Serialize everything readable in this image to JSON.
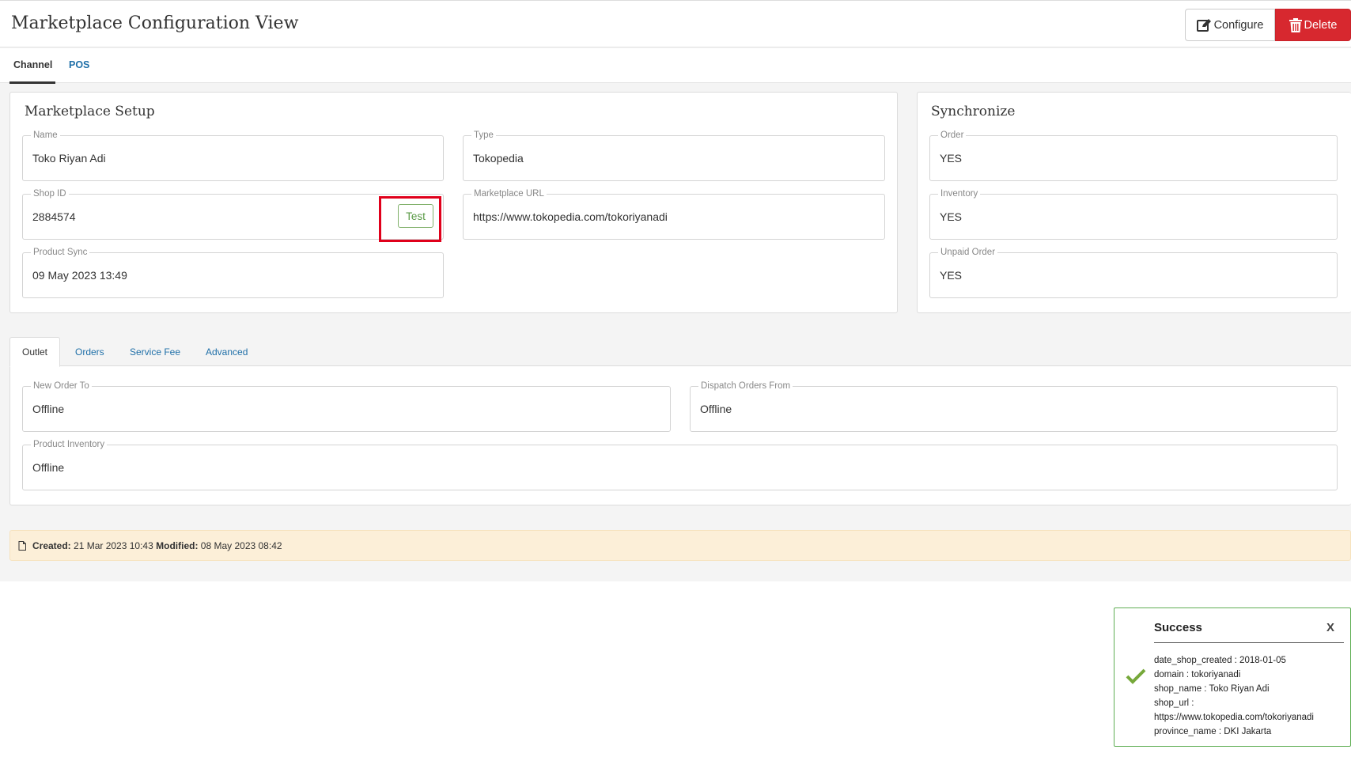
{
  "header": {
    "title": "Marketplace Configuration View",
    "configure_label": "Configure",
    "delete_label": "Delete"
  },
  "main_tabs": [
    {
      "label": "Channel",
      "active": true
    },
    {
      "label": "POS",
      "active": false
    }
  ],
  "setup": {
    "title": "Marketplace Setup",
    "name": {
      "label": "Name",
      "value": "Toko Riyan Adi"
    },
    "type": {
      "label": "Type",
      "value": "Tokopedia"
    },
    "shop_id": {
      "label": "Shop ID",
      "value": "2884574"
    },
    "test_label": "Test",
    "marketplace_url": {
      "label": "Marketplace URL",
      "value": "https://www.tokopedia.com/tokoriyanadi"
    },
    "product_sync": {
      "label": "Product Sync",
      "value": "09 May 2023 13:49"
    }
  },
  "synchronize": {
    "title": "Synchronize",
    "order": {
      "label": "Order",
      "value": "YES"
    },
    "inventory": {
      "label": "Inventory",
      "value": "YES"
    },
    "unpaid_order": {
      "label": "Unpaid Order",
      "value": "YES"
    }
  },
  "sub_tabs": [
    {
      "label": "Outlet",
      "active": true
    },
    {
      "label": "Orders",
      "active": false
    },
    {
      "label": "Service Fee",
      "active": false
    },
    {
      "label": "Advanced",
      "active": false
    }
  ],
  "outlet": {
    "new_order_to": {
      "label": "New Order To",
      "value": "Offline"
    },
    "dispatch_orders_from": {
      "label": "Dispatch Orders From",
      "value": "Offline"
    },
    "product_inventory": {
      "label": "Product Inventory",
      "value": "Offline"
    }
  },
  "info": {
    "created_label": "Created:",
    "created_value": "21 Mar 2023 10:43",
    "modified_label": "Modified:",
    "modified_value": "08 May 2023 08:42"
  },
  "toast": {
    "title": "Success",
    "close": "X",
    "lines": [
      "date_shop_created : 2018-01-05",
      "domain : tokoriyanadi",
      "shop_name : Toko Riyan Adi",
      "shop_url :",
      "https://www.tokopedia.com/tokoriyanadi",
      "province_name : DKI Jakarta"
    ]
  },
  "colors": {
    "delete": "#d7282f",
    "link": "#1f6fa8",
    "success": "#5fae53",
    "highlight": "#e0001b",
    "info_bg": "#fcefd8"
  },
  "icons": {
    "configure": "edit-icon",
    "delete": "trash-icon",
    "info": "document-icon",
    "toast": "checkmark-icon"
  }
}
